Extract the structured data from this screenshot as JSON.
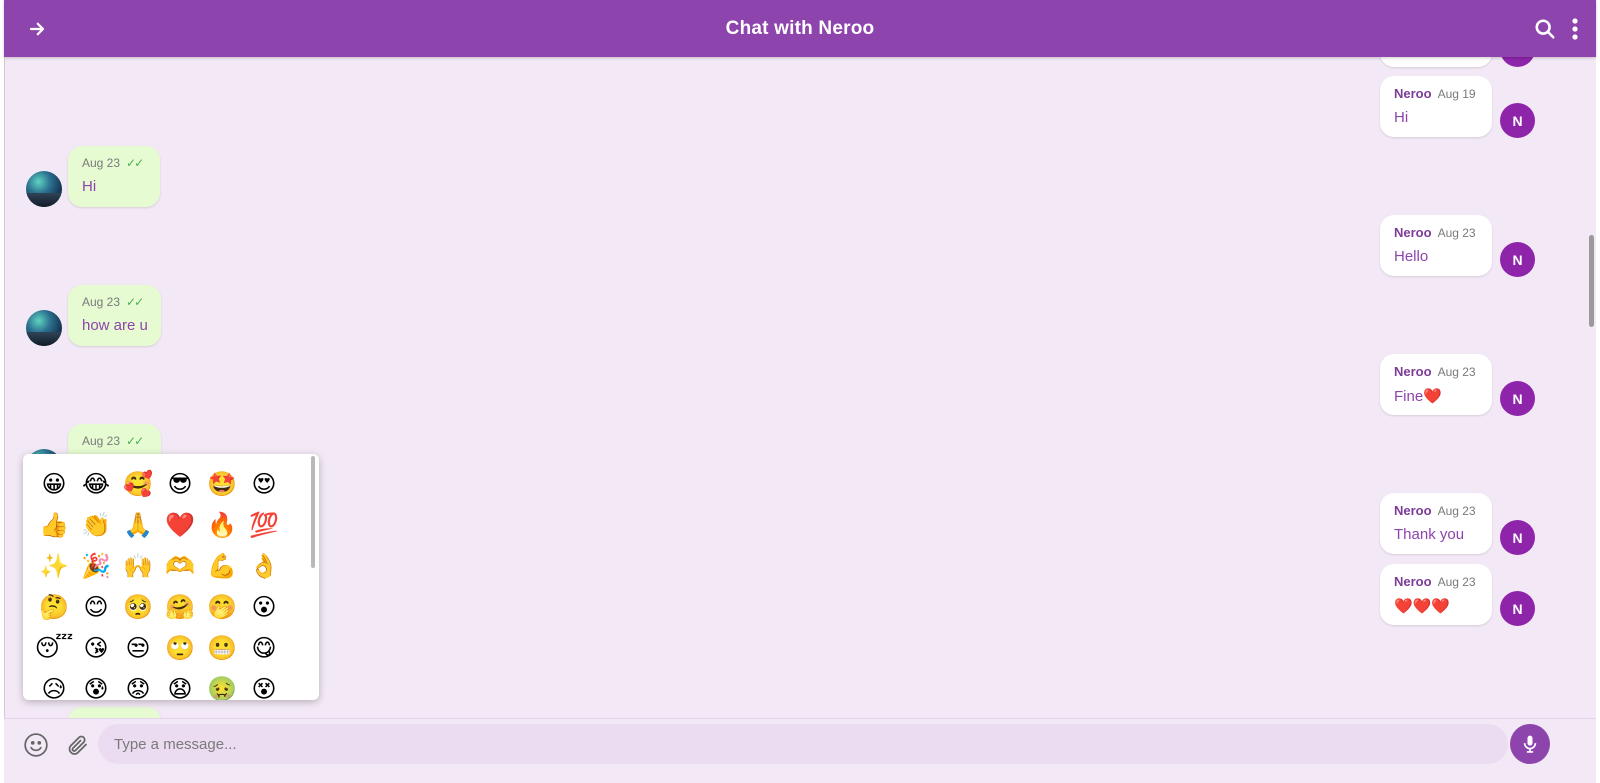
{
  "header": {
    "title": "Chat with Neroo",
    "back_icon": "arrow-right-icon",
    "search_icon": "search-icon",
    "more_icon": "more-vertical-icon"
  },
  "colors": {
    "accent": "#8e44ad",
    "background": "#f3e9f6",
    "outgoing_bubble": "#e6fbd2",
    "incoming_bubble": "#ffffff"
  },
  "messages": [
    {
      "id": "in-0",
      "direction": "in",
      "sender": "Neroo",
      "time": "",
      "text": ""
    },
    {
      "id": "in-1",
      "direction": "in",
      "sender": "Neroo",
      "time": "Aug 19",
      "text": "Hi",
      "avatar": "N"
    },
    {
      "id": "out-1",
      "direction": "out",
      "time": "Aug 23",
      "ticks": "✓✓",
      "text": "Hi"
    },
    {
      "id": "in-2",
      "direction": "in",
      "sender": "Neroo",
      "time": "Aug 23",
      "text": "Hello",
      "avatar": "N"
    },
    {
      "id": "out-2",
      "direction": "out",
      "time": "Aug 23",
      "ticks": "✓✓",
      "text": "how are u"
    },
    {
      "id": "in-3",
      "direction": "in",
      "sender": "Neroo",
      "time": "Aug 23",
      "text": "Fine❤️",
      "avatar": "N"
    },
    {
      "id": "out-3",
      "direction": "out",
      "time": "Aug 23",
      "ticks": "✓✓",
      "text": ""
    },
    {
      "id": "in-4",
      "direction": "in",
      "sender": "Neroo",
      "time": "Aug 23",
      "text": "Thank you",
      "avatar": "N"
    },
    {
      "id": "in-5",
      "direction": "in",
      "sender": "Neroo",
      "time": "Aug 23",
      "text": "❤️❤️❤️",
      "avatar": "N"
    }
  ],
  "emoji_picker": {
    "emojis": [
      "😀",
      "😂",
      "🥰",
      "😎",
      "🤩",
      "😍",
      "👍",
      "👏",
      "🙏",
      "❤️",
      "🔥",
      "💯",
      "✨",
      "🎉",
      "🙌",
      "🫶",
      "💪",
      "👌",
      "🤔",
      "😊",
      "🥺",
      "🤗",
      "🤭",
      "😮",
      "😴",
      "😘",
      "😒",
      "🙄",
      "😬",
      "😋",
      "😥",
      "😰",
      "😟",
      "😧",
      "🤢",
      "😵"
    ]
  },
  "input": {
    "placeholder": "Type a message...",
    "value": "",
    "emoji_button_icon": "smile-icon",
    "attach_button_icon": "paperclip-icon",
    "mic_button_icon": "microphone-icon"
  }
}
